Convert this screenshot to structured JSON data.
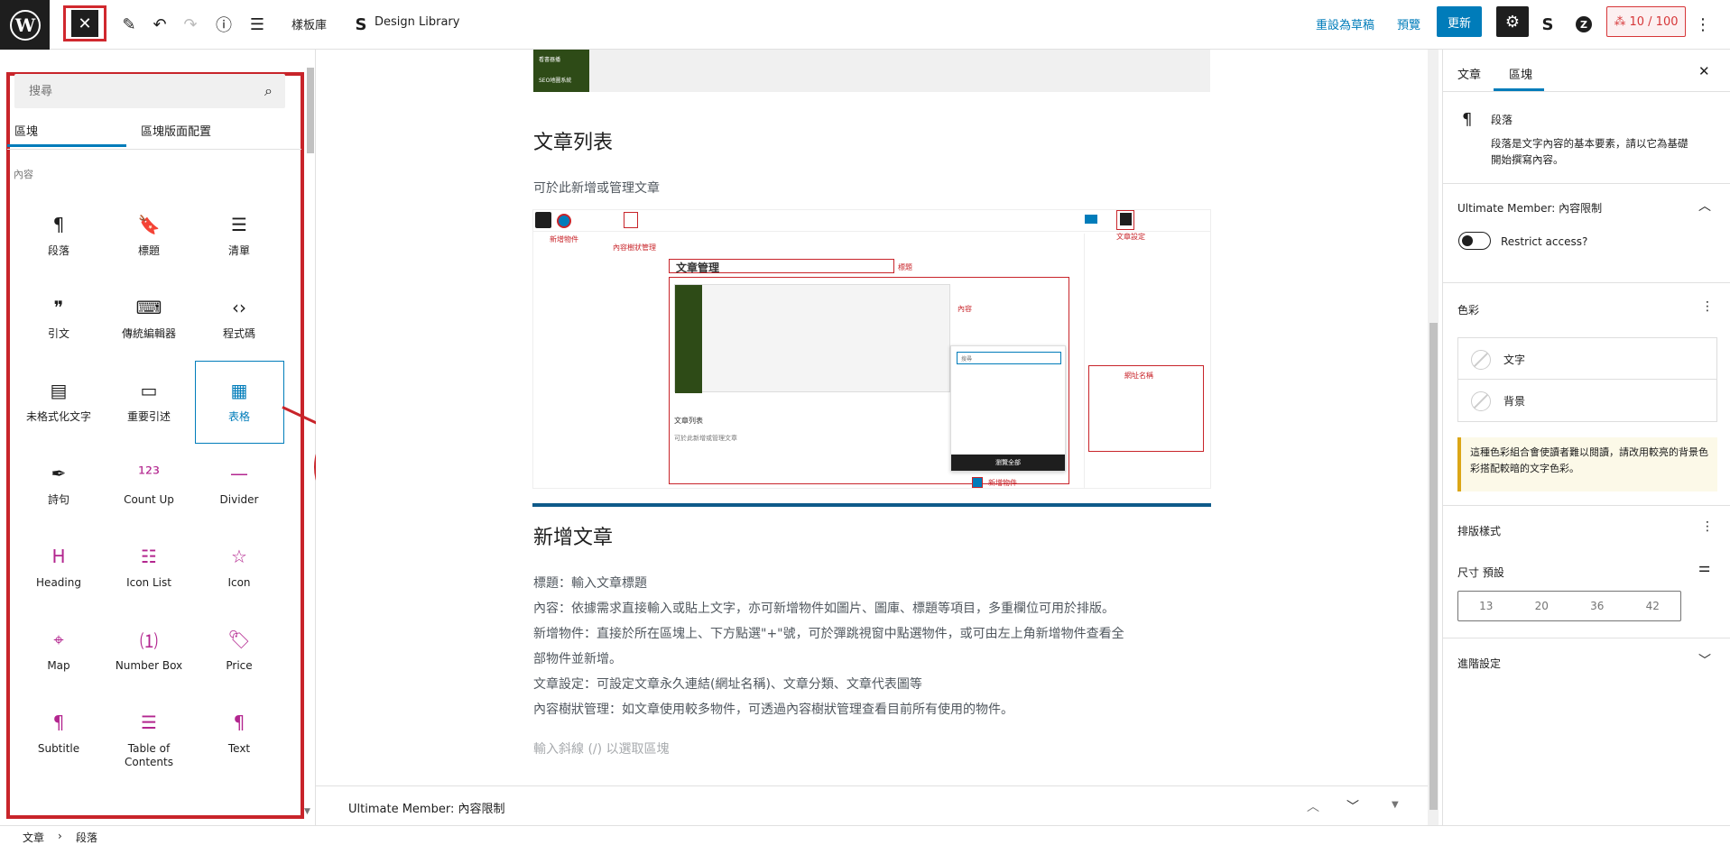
{
  "topbar": {
    "block_library": "樣板庫",
    "design_library": "Design Library",
    "save_draft": "重設為草稿",
    "preview": "預覽",
    "update": "更新",
    "score": "10 / 100"
  },
  "inserter": {
    "search_placeholder": "搜尋",
    "tabs": [
      "區塊",
      "區塊版面配置"
    ],
    "category": "內容",
    "blocks": [
      {
        "label": "段落",
        "icon": "paragraph-icon",
        "glyph": "¶"
      },
      {
        "label": "標題",
        "icon": "bookmark-icon",
        "glyph": "🔖"
      },
      {
        "label": "清單",
        "icon": "list-icon",
        "glyph": "☰"
      },
      {
        "label": "引文",
        "icon": "quote-icon",
        "glyph": "❞"
      },
      {
        "label": "傳統編輯器",
        "icon": "keyboard-icon",
        "glyph": "⌨"
      },
      {
        "label": "程式碼",
        "icon": "code-icon",
        "glyph": "‹›"
      },
      {
        "label": "未格式化文字",
        "icon": "preformatted-icon",
        "glyph": "▤"
      },
      {
        "label": "重要引述",
        "icon": "pullquote-icon",
        "glyph": "▭"
      },
      {
        "label": "表格",
        "icon": "table-icon",
        "glyph": "▦"
      },
      {
        "label": "詩句",
        "icon": "verse-icon",
        "glyph": "✒"
      },
      {
        "label": "Count Up",
        "icon": "count-up-icon",
        "glyph": "¹²³"
      },
      {
        "label": "Divider",
        "icon": "divider-icon",
        "glyph": "—"
      },
      {
        "label": "Heading",
        "icon": "heading-icon",
        "glyph": "H"
      },
      {
        "label": "Icon List",
        "icon": "icon-list-icon",
        "glyph": "☷"
      },
      {
        "label": "Icon",
        "icon": "star-icon",
        "glyph": "☆"
      },
      {
        "label": "Map",
        "icon": "map-pin-icon",
        "glyph": "⌖"
      },
      {
        "label": "Number Box",
        "icon": "number-box-icon",
        "glyph": "⑴"
      },
      {
        "label": "Price",
        "icon": "price-tag-icon",
        "glyph": "🏷"
      },
      {
        "label": "Subtitle",
        "icon": "subtitle-icon",
        "glyph": "¶"
      },
      {
        "label": "Table of Contents",
        "icon": "toc-icon",
        "glyph": "☰"
      },
      {
        "label": "Text",
        "icon": "text-icon",
        "glyph": "¶"
      }
    ]
  },
  "canvas": {
    "top_image_lines": [
      "看書器播",
      "SEO地圖系統"
    ],
    "section1_title": "文章列表",
    "section1_desc": "可於此新增或管理文章",
    "mini": {
      "title": "文章管理",
      "add_object": "新增物件",
      "outline_mgmt": "內容樹狀管理",
      "label_title": "標題",
      "label_content": "內容",
      "label_settings": "文章設定",
      "label_slug": "網址名稱",
      "article_list": "文章列表",
      "desc": "可於此新增或管理文章",
      "add_object_bottom": "新增物件",
      "browse_all": "瀏覽全部",
      "search": "搜尋"
    },
    "section2_title": "新增文章",
    "section2_lines": [
      "標題：輸入文章標題",
      "內容：依據需求直接輸入或貼上文字，亦可新增物件如圖片、圖庫、標題等項目，多重欄位可用於排版。",
      "新增物件：直接於所在區塊上、下方點選\"+\"號，可於彈跳視窗中點選物件，或可由左上角新增物件查看全",
      "部物件並新增。",
      "文章設定：可設定文章永久連結(網址名稱)、文章分類、文章代表圖等",
      "內容樹狀管理：如文章使用較多物件，可透過內容樹狀管理查看目前所有使用的物件。"
    ],
    "placeholder": "輸入斜線 (/) 以選取區塊",
    "bottom_panel": "Ultimate Member: 內容限制"
  },
  "sidebar": {
    "tabs": [
      "文章",
      "區塊"
    ],
    "block_name": "段落",
    "block_desc_1": "段落是文字內容的基本要素，請以它為基礎",
    "block_desc_2": "開始撰寫內容。",
    "um_title": "Ultimate Member: 內容限制",
    "restrict": "Restrict access?",
    "color_title": "色彩",
    "color_text": "文字",
    "color_bg": "背景",
    "warning": "這種色彩組合會使讀者難以閱讀，請改用較亮的背景色彩搭配較暗的文字色彩。",
    "typography": "排版樣式",
    "size_label": "尺寸",
    "size_default": "預設",
    "sizes": [
      "13",
      "20",
      "36",
      "42"
    ],
    "advanced": "進階設定"
  },
  "breadcrumb": [
    "文章",
    "段落"
  ],
  "colors": {
    "accent": "#007cba",
    "annotation": "#c8242a",
    "dark": "#1e1e1e"
  }
}
